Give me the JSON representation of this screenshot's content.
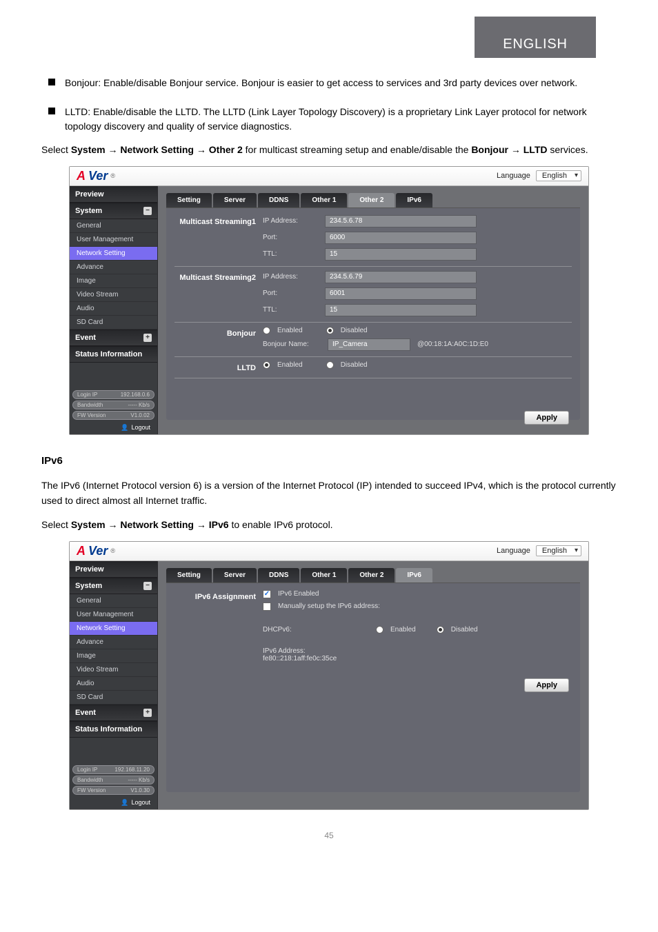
{
  "lang_tab": "ENGLISH",
  "bullets": [
    "Bonjour: Enable/disable Bonjour service. Bonjour is easier to get access to services and 3rd party devices over network.",
    "LLTD: Enable/disable the LLTD. The LLTD (Link Layer Topology Discovery) is a proprietary Link Layer protocol for network topology discovery and quality of service diagnostics."
  ],
  "desc_para_prefix": "Select ",
  "desc_chain": [
    "System",
    "Network Setting",
    "Other 2"
  ],
  "desc_clause2_prefix": " for multicast streaming setup and enable/disable the ",
  "desc_chain2": [
    "Bonjour",
    "LLTD"
  ],
  "desc_suffix": " services.",
  "apply_btn": "Apply",
  "language_label": "Language",
  "language_value": "English",
  "sidebar": {
    "preview": "Preview",
    "system": "System",
    "items": [
      "General",
      "User Management",
      "Network Setting",
      "Advance",
      "Image",
      "Video Stream",
      "Audio",
      "SD Card"
    ],
    "event": "Event",
    "status": "Status Information",
    "footer1": {
      "login_ip_lbl": "Login IP",
      "login_ip_a": "192.168.0.6",
      "login_ip_b": "192.168.11.20",
      "bw_lbl": "Bandwidth",
      "bw": "----- Kb/s",
      "fw_lbl": "FW Version",
      "fw_a": "V1.0.02",
      "fw_b": "V1.0.30"
    },
    "logout": "Logout"
  },
  "screenshot1": {
    "tabs": [
      "Setting",
      "Server",
      "DDNS",
      "Other 1",
      "Other 2",
      "IPv6"
    ],
    "active_tab": 4,
    "ms1_title": "Multicast Streaming1",
    "ms2_title": "Multicast Streaming2",
    "fields": {
      "ip": "IP Address:",
      "port": "Port:",
      "ttl": "TTL:"
    },
    "ms1": {
      "ip": "234.5.6.78",
      "port": "6000",
      "ttl": "15"
    },
    "ms2": {
      "ip": "234.5.6.79",
      "port": "6001",
      "ttl": "15"
    },
    "bonjour": {
      "title": "Bonjour",
      "enabled": "Enabled",
      "disabled": "Disabled",
      "name_lbl": "Bonjour Name:",
      "name_val": "IP_Camera",
      "suffix": "@00:18:1A:A0C:1D:E0"
    },
    "lltd": {
      "title": "LLTD",
      "enabled": "Enabled",
      "disabled": "Disabled"
    }
  },
  "section2": {
    "title": "IPv6",
    "para": "The IPv6 (Internet Protocol version 6) is a version of the Internet Protocol (IP) intended to succeed IPv4, which is the protocol currently used to direct almost all Internet traffic.",
    "para2_prefix": "Select ",
    "para2_chain": [
      "System",
      "Network Setting",
      "IPv6"
    ],
    "para2_suffix": " to enable IPv6 protocol."
  },
  "screenshot2": {
    "tabs": [
      "Setting",
      "Server",
      "DDNS",
      "Other 1",
      "Other 2",
      "IPv6"
    ],
    "active_tab": 5,
    "assign_title": "IPv6 Assignment",
    "enabled": "IPv6 Enabled",
    "manual": "Manually setup the IPv6 address:",
    "dhcp_lbl": "DHCPv6:",
    "dhcp_en": "Enabled",
    "dhcp_dis": "Disabled",
    "addr_lbl": "IPv6 Address:",
    "addr_val": "fe80::218:1aff:fe0c:35ce"
  },
  "page_number": "45"
}
